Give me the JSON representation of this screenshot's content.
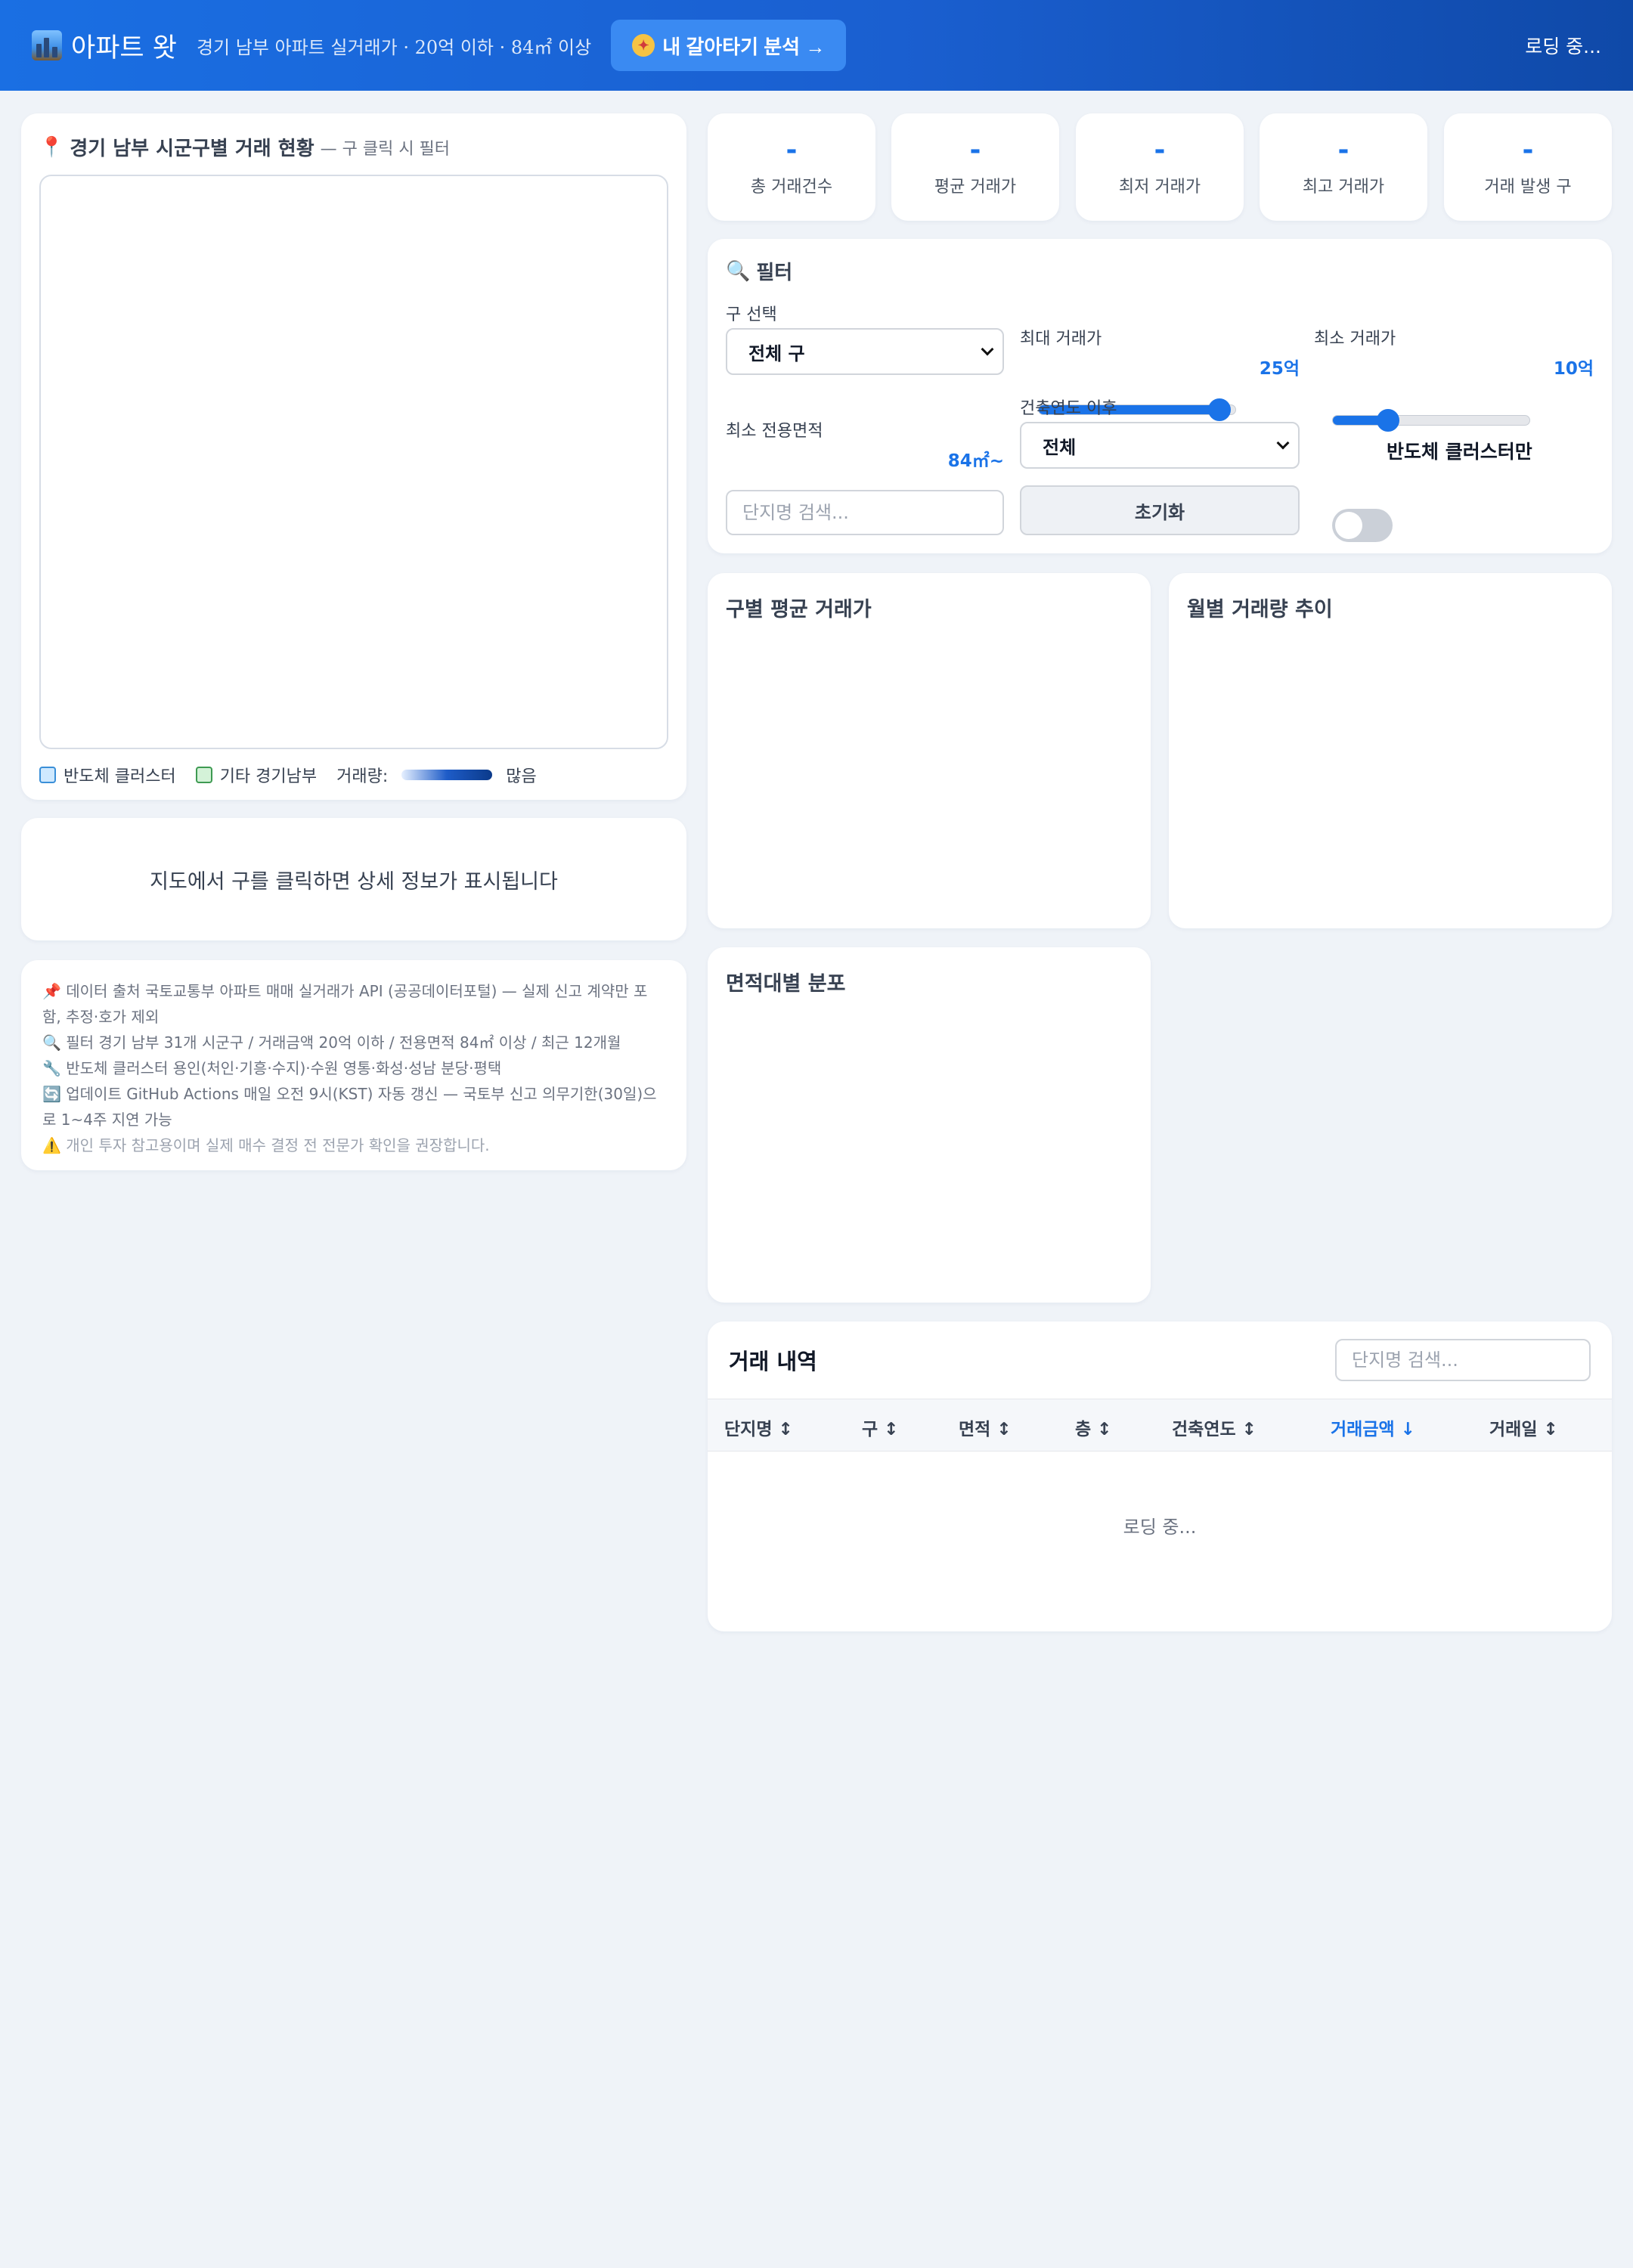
{
  "header": {
    "title": "아파트 왓",
    "subtitle": "경기 남부 아파트 실거래가 · 20억 이하 · 84㎡ 이상",
    "cta_label": "내 갈아타기 분석 →",
    "status": "로딩 중..."
  },
  "map": {
    "title": "경기 남부 시군구별 거래 현황",
    "subtitle": "— 구 클릭 시 필터",
    "legend": {
      "semi": "반도체 클러스터",
      "other": "기타 경기남부",
      "volume_label": "거래량:",
      "volume_high": "많음"
    }
  },
  "detail": {
    "placeholder": "지도에서 구를 클릭하면 상세 정보가 표시됩니다"
  },
  "notes": [
    "📌 데이터 출처 국토교통부 아파트 매매 실거래가 API (공공데이터포털) — 실제 신고 계약만 포함, 추정·호가 제외",
    "🔍 필터 경기 남부 31개 시군구 / 거래금액 20억 이하 / 전용면적 84㎡ 이상 / 최근 12개월",
    "🔧 반도체 클러스터 용인(처인·기흥·수지)·수원 영통·화성·성남 분당·평택",
    "🔄 업데이트 GitHub Actions 매일 오전 9시(KST) 자동 갱신 — 국토부 신고 의무기한(30일)으로 1~4주 지연 가능",
    "⚠️ 개인 투자 참고용이며 실제 매수 결정 전 전문가 확인을 권장합니다."
  ],
  "stats": [
    {
      "value": "-",
      "label": "총 거래건수"
    },
    {
      "value": "-",
      "label": "평균 거래가"
    },
    {
      "value": "-",
      "label": "최저 거래가"
    },
    {
      "value": "-",
      "label": "최고 거래가"
    },
    {
      "value": "-",
      "label": "거래 발생 구"
    }
  ],
  "filter": {
    "title": "필터",
    "district_label": "구 선택",
    "district_value": "전체 구",
    "max_price_label": "최대 거래가",
    "max_price_value": "25억",
    "max_price_fraction": 0.92,
    "min_price_label": "최소 거래가",
    "min_price_value": "10억",
    "min_price_fraction": 0.28,
    "min_area_label": "최소 전용면적",
    "min_area_value": "84㎡~",
    "min_area_fraction": 0.0,
    "year_label": "건축연도 이후",
    "year_value": "전체",
    "semi_toggle_label": "반도체 클러스터만",
    "search_placeholder": "단지명 검색...",
    "reset_label": "초기화"
  },
  "charts": {
    "district_avg_title": "구별 평균 거래가",
    "monthly_volume_title": "월별 거래량 추이",
    "area_dist_title": "면적대별 분포"
  },
  "table": {
    "title": "거래 내역",
    "search_placeholder": "단지명 검색...",
    "columns": [
      "단지명 ↕",
      "구 ↕",
      "면적 ↕",
      "층 ↕",
      "건축연도 ↕",
      "거래금액 ↓",
      "거래일 ↕"
    ],
    "loading": "로딩 중..."
  },
  "colors": {
    "accent": "#1a73e8",
    "header": "#1a5fd0",
    "background": "#eff3f8"
  }
}
